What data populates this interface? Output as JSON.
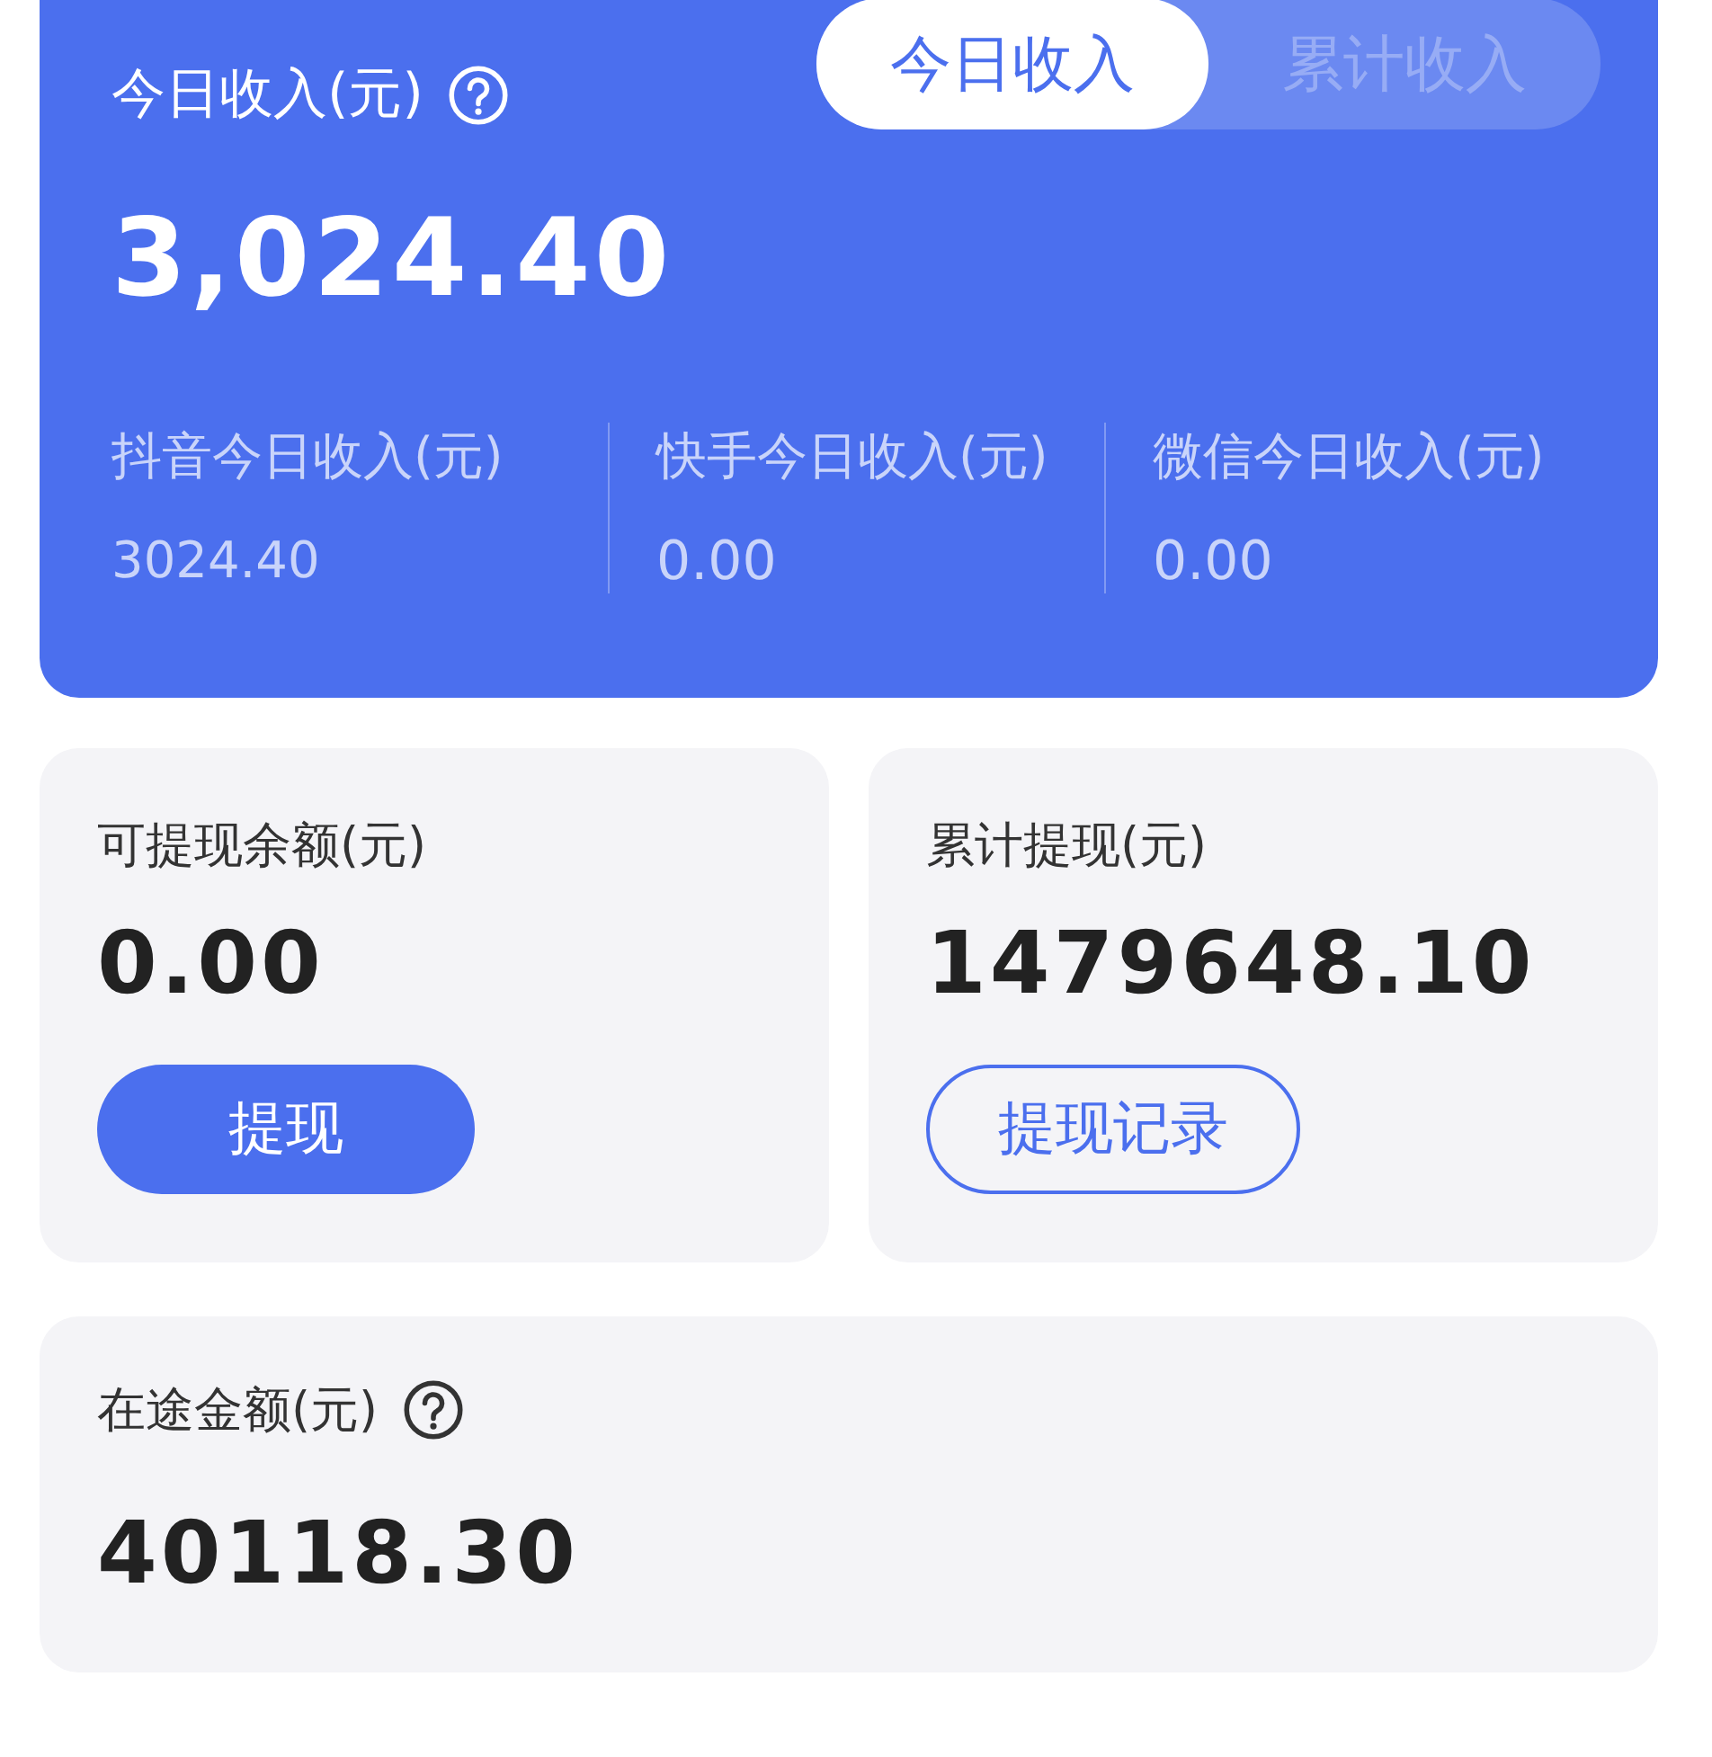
{
  "header": {
    "title": "今日收入(元)",
    "amount": "3,024.40",
    "tabs": [
      {
        "label": "今日收入",
        "selected": true
      },
      {
        "label": "累计收入",
        "selected": false
      }
    ],
    "platforms": [
      {
        "label": "抖音今日收入(元)",
        "value": "3024.40"
      },
      {
        "label": "快手今日收入(元)",
        "value": "0.00"
      },
      {
        "label": "微信今日收入(元)",
        "value": "0.00"
      }
    ]
  },
  "cards": [
    {
      "label": "可提现余额(元)",
      "value": "0.00",
      "button": {
        "label": "提现",
        "kind": "filled"
      }
    },
    {
      "label": "累计提现(元)",
      "value": "1479648.10",
      "button": {
        "label": "提现记录",
        "kind": "outline"
      }
    }
  ],
  "transit": {
    "label": "在途金额(元)",
    "value": "40118.30"
  }
}
